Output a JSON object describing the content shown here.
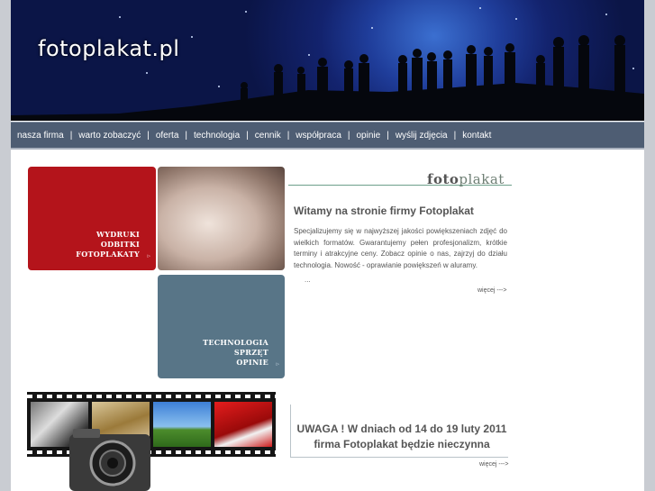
{
  "header": {
    "logo_text": "fotoplakat.pl"
  },
  "nav": {
    "items": [
      "nasza firma",
      "warto zobaczyć",
      "oferta",
      "technologia",
      "cennik",
      "współpraca",
      "opinie",
      "wyślij zdjęcia",
      "kontakt"
    ],
    "separator": "|"
  },
  "tiles": {
    "red": {
      "lines": [
        "WYDRUKI",
        "ODBITKI",
        "FOTOPLAKATY"
      ],
      "arrow": "▹"
    },
    "steel": {
      "lines": [
        "TECHNOLOGIA",
        "SPRZĘT",
        "OPINIE"
      ],
      "arrow": "▹"
    }
  },
  "brand": {
    "prefix": "foto",
    "suffix": "plakat"
  },
  "welcome": {
    "title": "Witamy na stronie firmy Fotoplakat",
    "body": "Specjalizujemy się w najwyższej jakości powiększeniach zdjęć do wielkich formatów. Gwarantujemy pełen profesjonalizm, krótkie terminy i atrakcyjne ceny. Zobacz opinie o nas, zajrzyj do działu technologia. Nowość - oprawianie powiększeń w aluramy.",
    "ellipsis": "...",
    "more": "więcej --->"
  },
  "notice": {
    "line1": "UWAGA ! W dniach od 14 do 19 luty 2011",
    "line2": "firma Fotoplakat będzie nieczynna",
    "more": "więcej --->"
  },
  "colors": {
    "nav_bg": "#4e5d73",
    "red_tile": "#b4141b",
    "steel_tile": "#587587",
    "header_sky": "#13236e"
  }
}
